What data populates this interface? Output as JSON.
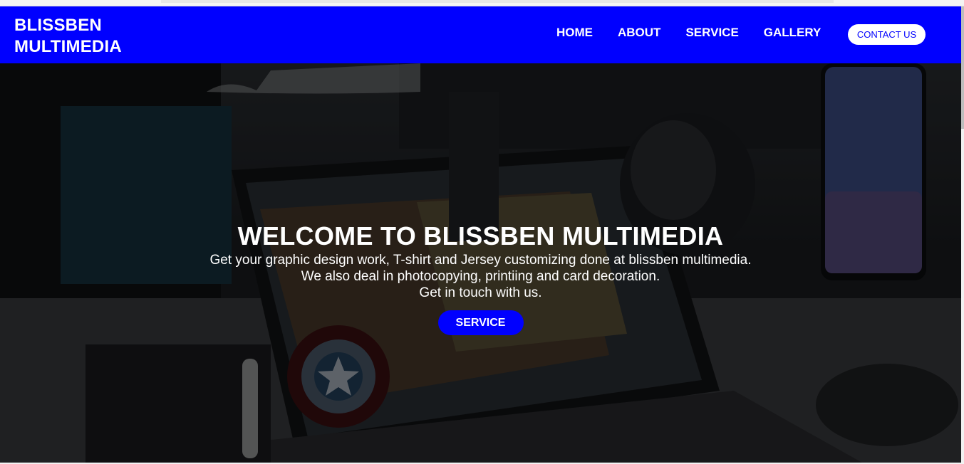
{
  "navbar": {
    "brand_line1": "BLISSBEN",
    "brand_line2": "MULTIMEDIA",
    "links": [
      "HOME",
      "ABOUT",
      "SERVICE",
      "GALLERY"
    ],
    "contact_label": "CONTACT US"
  },
  "hero": {
    "title": "WELCOME TO BLISSBEN MULTIMEDIA",
    "line1": "Get your graphic design work, T-shirt and Jersey customizing done at blissben multimedia.",
    "line2": "We also deal in photocopying, printiing and card decoration.",
    "line3": "Get in touch with us.",
    "button_label": "SERVICE"
  },
  "colors": {
    "brand_blue": "#0000ff",
    "text_white": "#ffffff",
    "hero_overlay": "rgba(0,0,0,0.45)"
  },
  "icons": {
    "background": "laptop-desk-photo"
  }
}
